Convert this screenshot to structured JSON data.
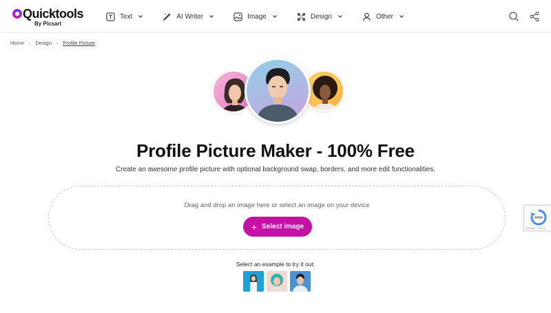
{
  "brand": {
    "name": "Quicktools",
    "sub": "By Picsart"
  },
  "nav": [
    {
      "label": "Text",
      "icon": "text-icon"
    },
    {
      "label": "AI Writer",
      "icon": "pen-icon"
    },
    {
      "label": "Image",
      "icon": "image-icon"
    },
    {
      "label": "Design",
      "icon": "design-icon"
    },
    {
      "label": "Other",
      "icon": "other-icon"
    }
  ],
  "header_icons": [
    "search-icon",
    "share-icon"
  ],
  "breadcrumb": {
    "home": "Home",
    "design": "Design",
    "current": "Profile Picture"
  },
  "hero": {
    "title_regular": "Profile Picture Maker",
    "title_bold": " - 100% Free",
    "subtitle": "Create an awesome profile picture with optional background swap, borders, and more edit functionalities."
  },
  "upload": {
    "instruction": "Drag and drop an image here or select an image on your device",
    "button_label": "Select image"
  },
  "examples": {
    "label": "Select an example to try it out:"
  },
  "recaptcha": {
    "text": "Privacy - Terms"
  },
  "colors": {
    "accent": "#c511a6",
    "border": "#c9c9c9",
    "text": "#111111"
  }
}
